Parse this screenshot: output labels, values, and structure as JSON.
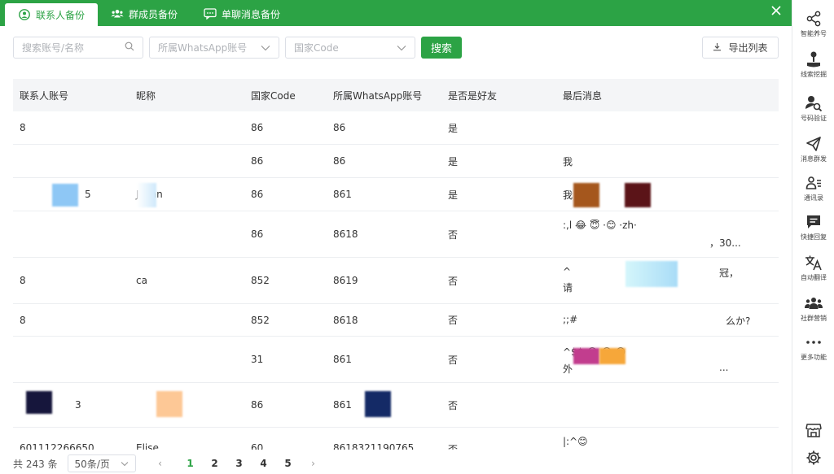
{
  "tabs": [
    {
      "label": "联系人备份",
      "active": true
    },
    {
      "label": "群成员备份",
      "active": false
    },
    {
      "label": "单聊消息备份",
      "active": false
    }
  ],
  "filters": {
    "search_placeholder": "搜索账号/名称",
    "account_placeholder": "所属WhatsApp账号",
    "code_placeholder": "国家Code",
    "search_button": "搜索",
    "export_button": "导出列表"
  },
  "table": {
    "headers": [
      "联系人账号",
      "昵称",
      "国家Code",
      "所属WhatsApp账号",
      "是否是好友",
      "最后消息"
    ],
    "rows": [
      {
        "account": "8",
        "nickname": "",
        "code": "86",
        "owner": "86",
        "friend": "是",
        "last_message": ""
      },
      {
        "account": "",
        "nickname": "",
        "code": "86",
        "owner": "86",
        "friend": "是",
        "last_message": "我"
      },
      {
        "account": "5",
        "nickname": "Julian",
        "code": "86",
        "owner": "861",
        "friend": "是",
        "last_message": "我"
      },
      {
        "account": "",
        "nickname": "",
        "code": "86",
        "owner": "8618",
        "friend": "否",
        "last_message": ":,l 😂 😇 ·😊 ·zh·",
        "last_message_2": "，30..."
      },
      {
        "account": "8",
        "nickname": "ca",
        "code": "852",
        "owner": "8619",
        "friend": "否",
        "last_message": "^",
        "last_message_2": "冠，",
        "last_message_3": "请"
      },
      {
        "account": "8",
        "nickname": "",
        "code": "852",
        "owner": "8618",
        "friend": "否",
        "last_message": ";;#",
        "last_message_2": "么か?"
      },
      {
        "account": "",
        "nickname": "",
        "code": "31",
        "owner": "861",
        "friend": "否",
        "last_message": "^$$ 😂 😂 😊",
        "last_message_2": "外",
        "last_message_3": "..."
      },
      {
        "account": "3",
        "nickname": "",
        "code": "86",
        "owner": "861",
        "friend": "否",
        "last_message": ""
      },
      {
        "account": "601112266650",
        "nickname": "Elise",
        "code": "60",
        "owner": "8618321190765",
        "friend": "否",
        "last_message": "|:^😊"
      }
    ]
  },
  "pagination": {
    "total_label": "共 243 条",
    "page_size": "50条/页",
    "prev": "‹",
    "next": "›",
    "pages": [
      "1",
      "2",
      "3",
      "4",
      "5"
    ],
    "current": "1"
  },
  "sidebar": {
    "items": [
      {
        "label": "智能养号",
        "icon": "share-nodes-icon"
      },
      {
        "label": "线索挖掘",
        "icon": "joystick-icon"
      },
      {
        "label": "号码验证",
        "icon": "user-search-icon"
      },
      {
        "label": "消息群发",
        "icon": "paper-plane-icon"
      },
      {
        "label": "通讯录",
        "icon": "contacts-icon"
      },
      {
        "label": "快捷回复",
        "icon": "chat-bubble-icon"
      },
      {
        "label": "自动翻译",
        "icon": "translate-icon"
      },
      {
        "label": "社群营销",
        "icon": "group-icon"
      },
      {
        "label": "更多功能",
        "icon": "more-icon"
      }
    ],
    "bottom_icons": [
      "store-icon",
      "settings-icon"
    ]
  },
  "colors": {
    "accent": "#2ca345",
    "header_bg": "#f4f5f7"
  }
}
